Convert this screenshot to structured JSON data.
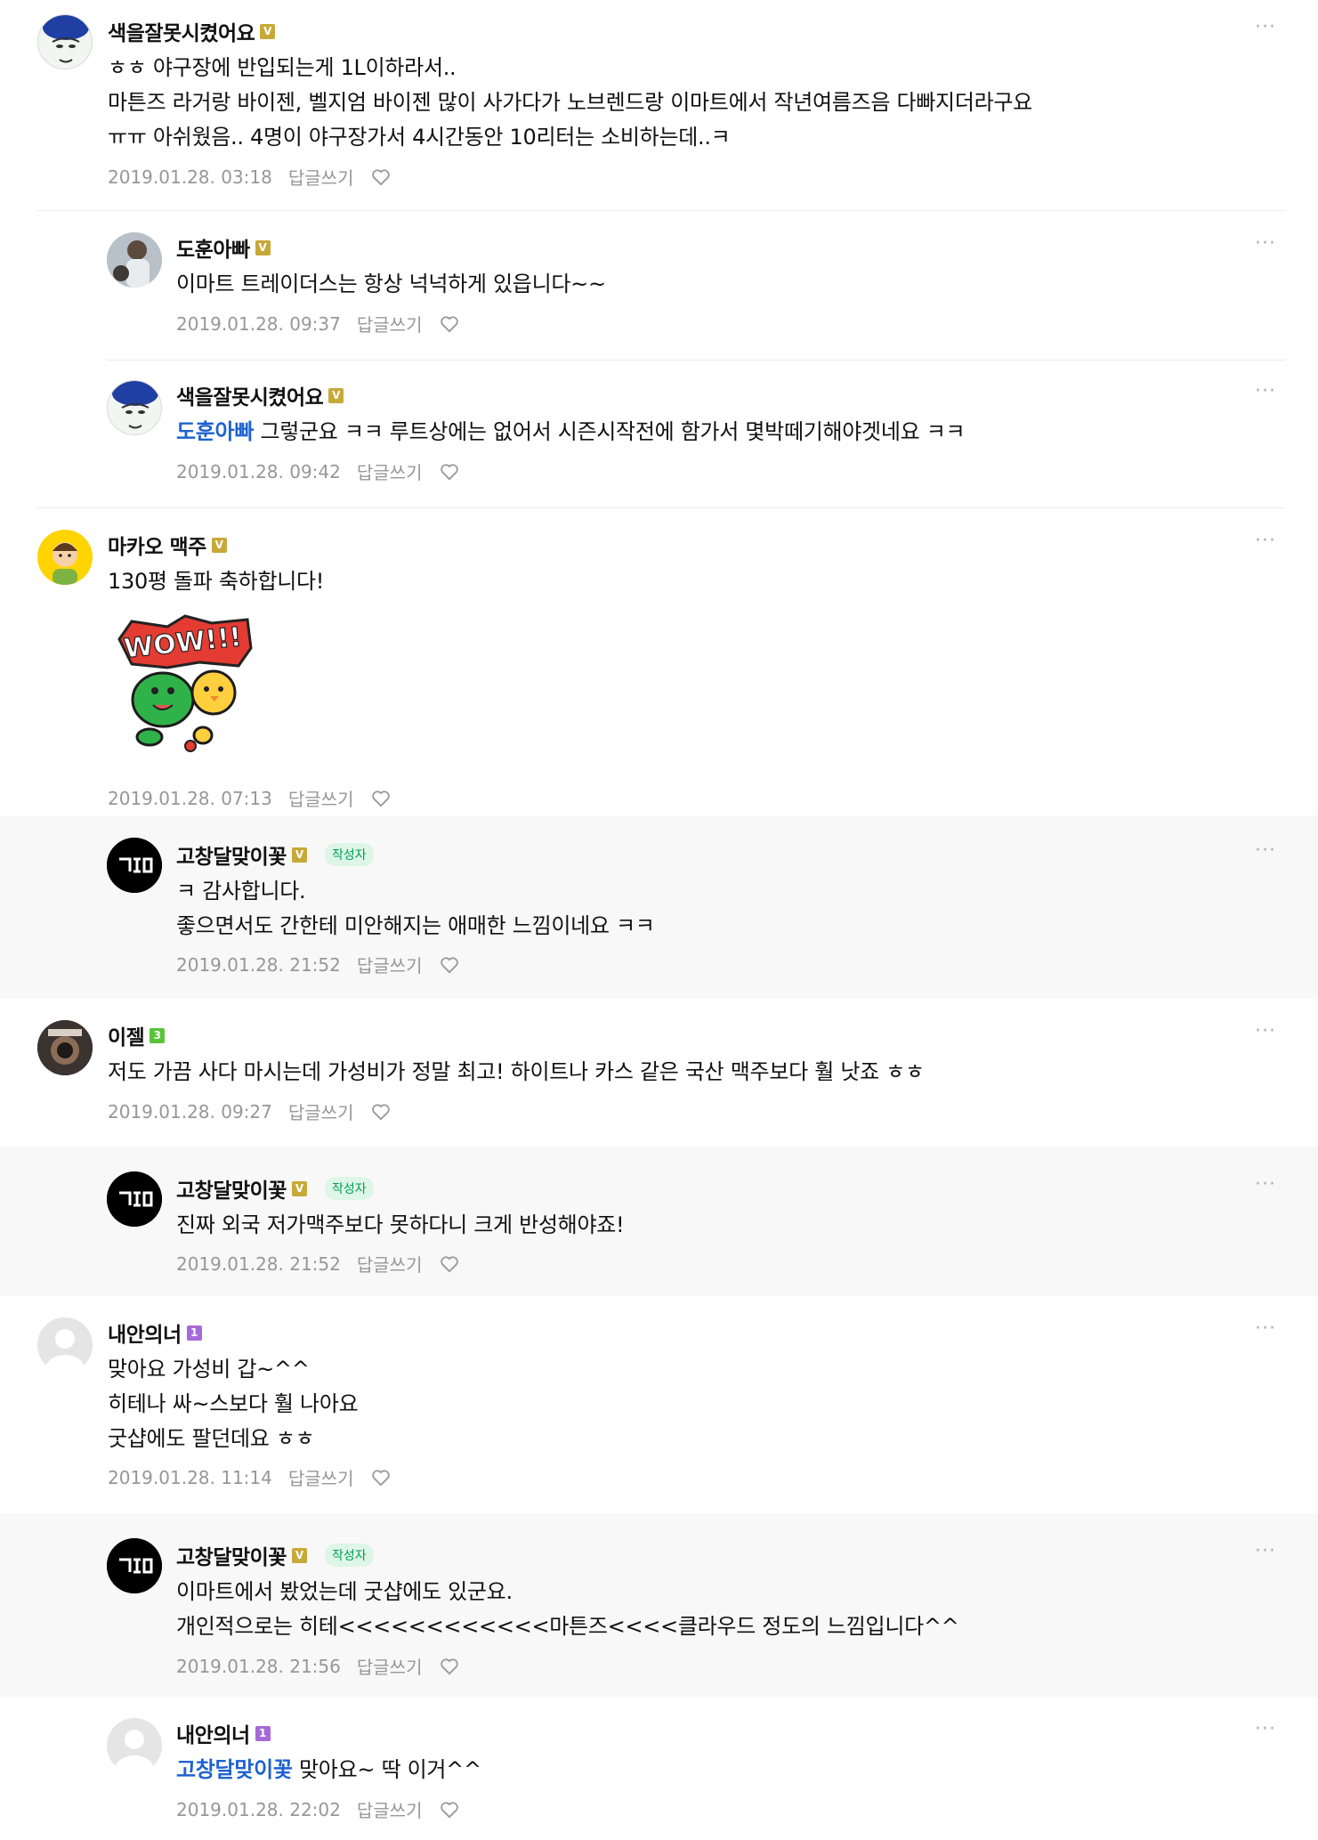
{
  "comments": [
    {
      "nickname": "색을잘못시켰어요",
      "level": "V",
      "lines": [
        "ㅎㅎ 야구장에 반입되는게 1L이하라서..",
        "마튼즈 라거랑 바이젠, 벨지엄 바이젠 많이 사가다가 노브렌드랑 이마트에서 작년여름즈음 다빠지더라구요",
        "ㅠㅠ 아쉬웠음.. 4명이 야구장가서 4시간동안 10리터는 소비하는데..ㅋ"
      ],
      "date": "2019.01.28. 03:18",
      "reply_label": "답글쓰기"
    },
    {
      "nickname": "도훈아빠",
      "level": "V",
      "lines": [
        "이마트 트레이더스는 항상 넉넉하게 있읍니다~~"
      ],
      "date": "2019.01.28. 09:37",
      "reply_label": "답글쓰기"
    },
    {
      "nickname": "색을잘못시켰어요",
      "level": "V",
      "mention": "도훈아빠",
      "lines": [
        "그렇군요 ㅋㅋ 루트상에는 없어서 시즌시작전에 함가서 몇박떼기해야겟네요 ㅋㅋ"
      ],
      "date": "2019.01.28. 09:42",
      "reply_label": "답글쓰기"
    },
    {
      "nickname": "마카오 맥주",
      "level": "V",
      "lines": [
        "130평 돌파 축하합니다!"
      ],
      "sticker_text": "WOW!!!",
      "date": "2019.01.28. 07:13",
      "reply_label": "답글쓰기"
    },
    {
      "nickname": "고창달맞이꽃",
      "level": "V",
      "badge": "작성자",
      "lines": [
        "ㅋ 감사합니다.",
        "좋으면서도 간한테 미안해지는 애매한 느낌이네요 ㅋㅋ"
      ],
      "date": "2019.01.28. 21:52",
      "reply_label": "답글쓰기"
    },
    {
      "nickname": "이젤",
      "level": "3",
      "lines": [
        "저도 가끔 사다 마시는데 가성비가 정말 최고! 하이트나 카스 같은 국산 맥주보다 훨 낫죠 ㅎㅎ"
      ],
      "date": "2019.01.28. 09:27",
      "reply_label": "답글쓰기"
    },
    {
      "nickname": "고창달맞이꽃",
      "level": "V",
      "badge": "작성자",
      "lines": [
        "진짜 외국 저가맥주보다 못하다니 크게 반성해야죠!"
      ],
      "date": "2019.01.28. 21:52",
      "reply_label": "답글쓰기"
    },
    {
      "nickname": "내안의너",
      "level": "1",
      "lines": [
        "맞아요 가성비 갑~^^",
        "히테나 싸~스보다 훨 나아요",
        "굿샵에도 팔던데요 ㅎㅎ"
      ],
      "date": "2019.01.28. 11:14",
      "reply_label": "답글쓰기"
    },
    {
      "nickname": "고창달맞이꽃",
      "level": "V",
      "badge": "작성자",
      "lines": [
        "이마트에서 봤었는데 굿샵에도 있군요.",
        "개인적으로는 히테<<<<<<<<<<<<마튼즈<<<<클라우드 정도의 느낌입니다^^"
      ],
      "date": "2019.01.28. 21:56",
      "reply_label": "답글쓰기"
    },
    {
      "nickname": "내안의너",
      "level": "1",
      "mention": "고창달맞이꽃",
      "lines": [
        "맞아요~ 딱 이거^^"
      ],
      "date": "2019.01.28. 22:02",
      "reply_label": "답글쓰기"
    }
  ],
  "more_label": "···",
  "icons": {
    "like": "heart-outline-icon",
    "more": "more-dots-icon"
  }
}
